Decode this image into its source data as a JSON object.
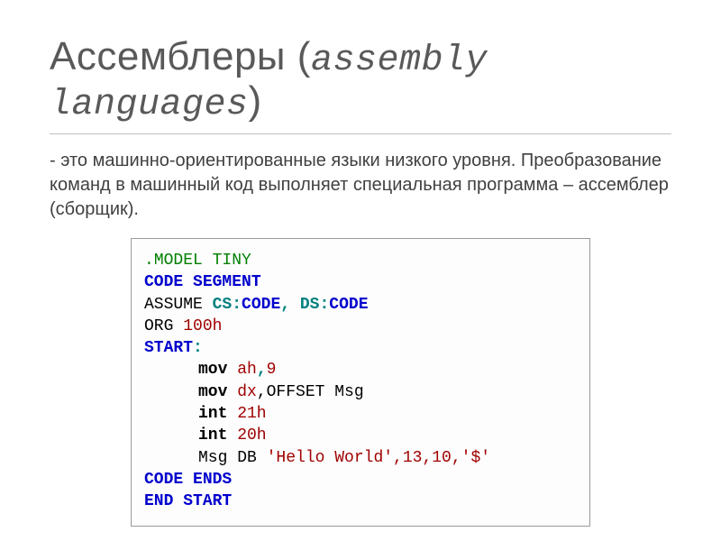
{
  "title_main": "Ассемблеры",
  "title_paren_open": " (",
  "title_italic": "assembly languages",
  "title_paren_close": ")",
  "body_text": "- это машинно-ориентированные языки низкого уровня. Преобразование команд в машинный код выполняет специальная программа – ассемблер (сборщик).",
  "code": {
    "l1_dot": ".",
    "l1_model": "MODEL TINY",
    "l2_code": "CODE",
    "l2_segment": " SEGMENT",
    "l3_assume": "ASSUME ",
    "l3_cs": "CS",
    "l3_colon1": ":",
    "l3_code1": "CODE",
    "l3_comma": ", ",
    "l3_ds": "DS",
    "l3_colon2": ":",
    "l3_code2": "CODE",
    "l4_org": "ORG ",
    "l4_val": "100h",
    "l5_start": "START",
    "l5_colon": ":",
    "l6_mov": "mov",
    "l6_ah": " ah",
    "l6_comma": ",",
    "l6_9": "9",
    "l7_mov": "mov",
    "l7_dx": " dx",
    "l7_rest": ",OFFSET Msg",
    "l8_int": "int",
    "l8_21": " 21h",
    "l9_int": "int",
    "l9_20": " 20h",
    "l10_msg": "Msg DB ",
    "l10_str": "'Hello World',13,10,'$'",
    "l11_code": "CODE",
    "l11_ends": " ENDS",
    "l12_end": "END ",
    "l12_start": "START"
  }
}
